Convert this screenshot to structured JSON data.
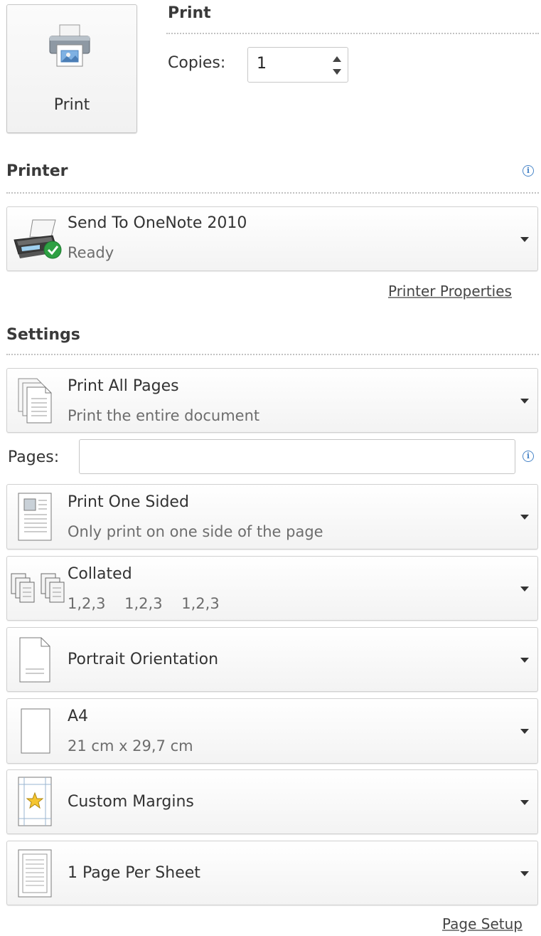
{
  "print_button": {
    "label": "Print",
    "icon": "printer-icon"
  },
  "print_section": {
    "title": "Print",
    "copies_label": "Copies:",
    "copies_value": "1"
  },
  "printer": {
    "title": "Printer",
    "name": "Send To OneNote 2010",
    "status": "Ready",
    "properties_link": "Printer Properties"
  },
  "settings": {
    "title": "Settings",
    "pages_label": "Pages:",
    "pages_value": "",
    "items": [
      {
        "label": "Print All Pages",
        "sub": "Print the entire document",
        "icon": "pages-stack-icon"
      },
      {
        "label": "Print One Sided",
        "sub": "Only print on one side of the page",
        "icon": "one-sided-icon"
      },
      {
        "label": "Collated",
        "sub": "1,2,3    1,2,3    1,2,3",
        "icon": "collated-icon"
      },
      {
        "label": "Portrait Orientation",
        "sub": "",
        "icon": "portrait-icon"
      },
      {
        "label": "A4",
        "sub": "21 cm x 29,7 cm",
        "icon": "paper-size-icon"
      },
      {
        "label": "Custom Margins",
        "sub": "",
        "icon": "margins-icon"
      },
      {
        "label": "1 Page Per Sheet",
        "sub": "",
        "icon": "pages-per-sheet-icon"
      }
    ],
    "page_setup_link": "Page Setup"
  }
}
